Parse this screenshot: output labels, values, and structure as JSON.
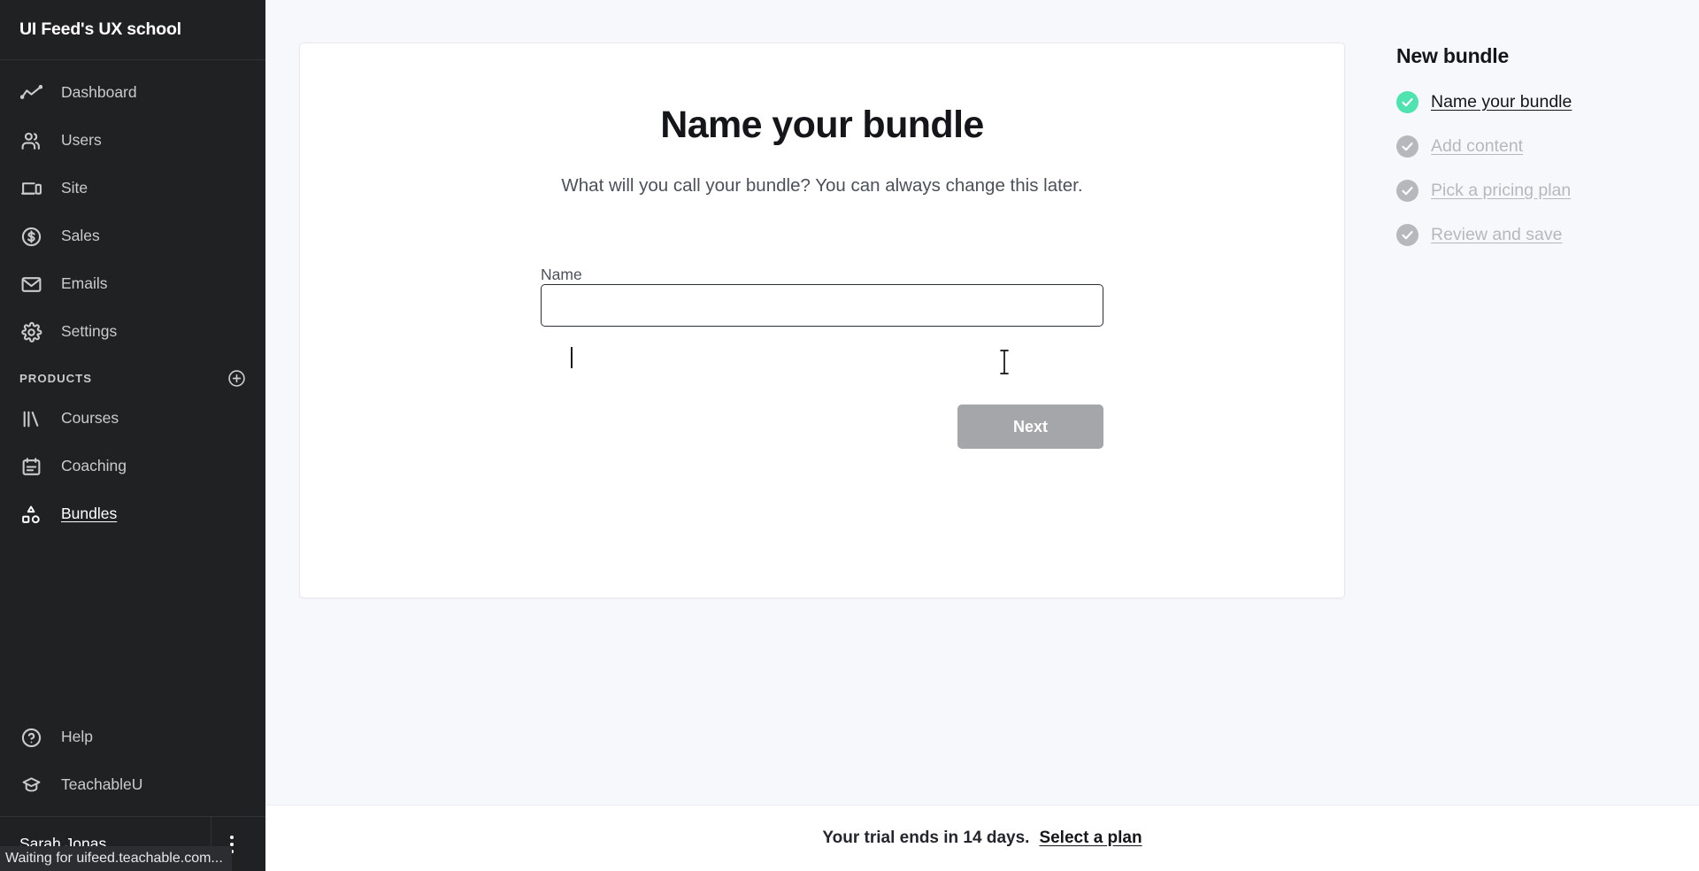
{
  "sidebar": {
    "brand": "UI Feed's UX school",
    "nav": [
      {
        "label": "Dashboard",
        "icon": "analytics-icon"
      },
      {
        "label": "Users",
        "icon": "users-icon"
      },
      {
        "label": "Site",
        "icon": "devices-icon"
      },
      {
        "label": "Sales",
        "icon": "dollar-circle-icon"
      },
      {
        "label": "Emails",
        "icon": "envelope-icon"
      },
      {
        "label": "Settings",
        "icon": "gear-icon"
      }
    ],
    "section": {
      "title": "PRODUCTS",
      "add_icon": "plus-circle-icon"
    },
    "products": [
      {
        "label": "Courses",
        "icon": "books-icon",
        "active": false
      },
      {
        "label": "Coaching",
        "icon": "calendar-icon",
        "active": false
      },
      {
        "label": "Bundles",
        "icon": "shapes-icon",
        "active": true
      }
    ],
    "bottom": [
      {
        "label": "Help",
        "icon": "question-circle-icon"
      },
      {
        "label": "TeachableU",
        "icon": "graduation-cap-icon"
      }
    ],
    "user": {
      "name": "Sarah Jonas",
      "menu_icon": "kebab-menu-icon"
    }
  },
  "main": {
    "title": "Name your bundle",
    "subtitle": "What will you call your bundle? You can always change this later.",
    "field": {
      "label": "Name",
      "value": "",
      "placeholder": ""
    },
    "next_button": "Next"
  },
  "steps_panel": {
    "title": "New bundle",
    "steps": [
      {
        "label": "Name your bundle",
        "state": "current"
      },
      {
        "label": "Add content",
        "state": "pending"
      },
      {
        "label": "Pick a pricing plan",
        "state": "pending"
      },
      {
        "label": "Review and save",
        "state": "pending"
      }
    ]
  },
  "trial_bar": {
    "text": "Your trial ends in 14 days.",
    "link": "Select a plan"
  },
  "status_bar": {
    "text": "Waiting for uifeed.teachable.com..."
  },
  "colors": {
    "sidebar_bg": "#1f2123",
    "page_bg": "#f7f8fc",
    "accent_done": "#4fe3b0",
    "step_pending": "#b6b8bd",
    "button_disabled": "#a4a6aa"
  }
}
